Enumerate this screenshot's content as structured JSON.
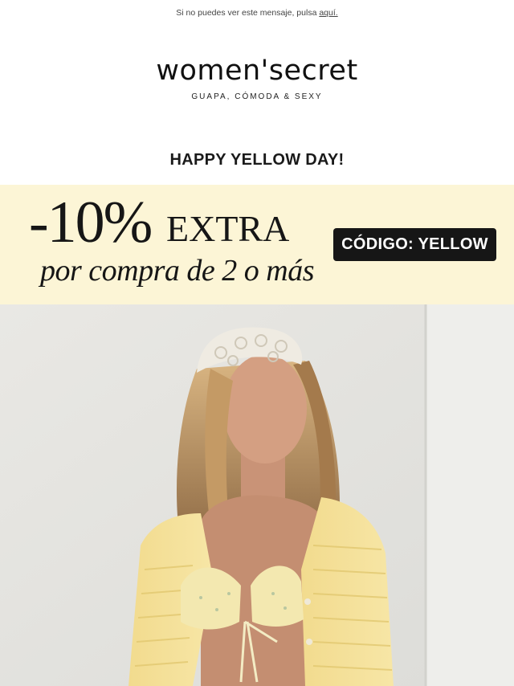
{
  "preheader": {
    "text": "Si no puedes ver este mensaje, pulsa ",
    "link": "aquí."
  },
  "brand": {
    "logo": "women'secret",
    "tagline": "GUAPA, CÓMODA & SEXY"
  },
  "headline": "HAPPY YELLOW DAY!",
  "promo": {
    "percent": "-10%",
    "extra": "EXTRA",
    "subtitle": "por compra de 2 o más",
    "code_label": "CÓDIGO: YELLOW",
    "background_color": "#fcf5d6"
  },
  "hero": {
    "image": "woman-yellow-knit-outfit"
  }
}
